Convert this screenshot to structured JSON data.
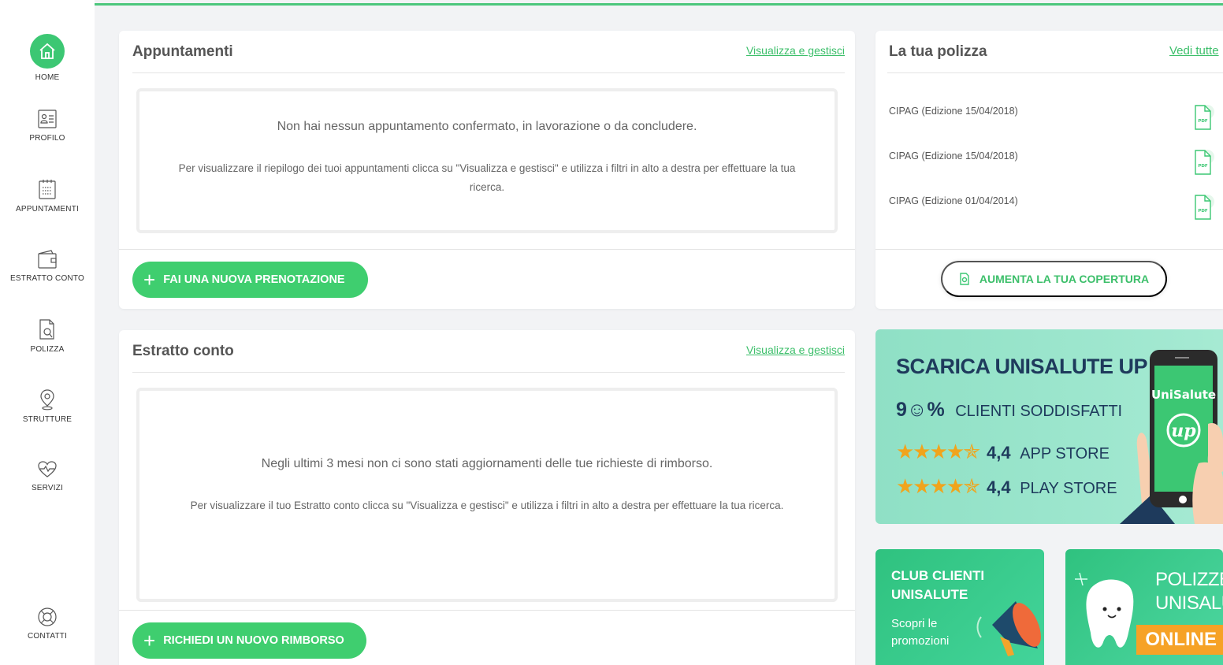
{
  "sidebar": {
    "items": [
      {
        "label": "HOME",
        "icon": "home-icon"
      },
      {
        "label": "PROFILO",
        "icon": "profile-card-icon"
      },
      {
        "label": "APPUNTAMENTI",
        "icon": "calendar-icon"
      },
      {
        "label": "ESTRATTO CONTO",
        "icon": "wallet-icon"
      },
      {
        "label": "POLIZZA",
        "icon": "document-search-icon"
      },
      {
        "label": "STRUTTURE",
        "icon": "location-pin-icon"
      },
      {
        "label": "SERVIZI",
        "icon": "heart-pulse-icon"
      },
      {
        "label": "CONTATTI",
        "icon": "lifebuoy-icon"
      }
    ]
  },
  "appointments": {
    "title": "Appuntamenti",
    "link": "Visualizza e gestisci",
    "empty_main": "Non hai nessun appuntamento confermato, in lavorazione o da concludere.",
    "empty_sub": "Per visualizzare il riepilogo dei tuoi appuntamenti clicca su \"Visualizza e gestisci\" e utilizza i filtri in alto a destra per effettuare la tua ricerca.",
    "button": "FAI UNA NUOVA PRENOTAZIONE"
  },
  "statement": {
    "title": "Estratto conto",
    "link": "Visualizza e gestisci",
    "empty_main": "Negli ultimi 3 mesi non ci sono stati aggiornamenti delle tue richieste di rimborso.",
    "empty_sub": "Per visualizzare il tuo Estratto conto clicca su \"Visualizza e gestisci\" e utilizza i filtri in alto a destra per effettuare la tua ricerca.",
    "button": "RICHIEDI UN NUOVO RIMBORSO"
  },
  "policy": {
    "title": "La tua polizza",
    "link": "Vedi tutte",
    "rows": [
      {
        "name": "CIPAG (Edizione 15/04/2018)",
        "icon": "pdf-icon"
      },
      {
        "name": "CIPAG (Edizione 15/04/2018)",
        "icon": "pdf-icon"
      },
      {
        "name": "CIPAG (Edizione 01/04/2014)",
        "icon": "pdf-icon"
      }
    ],
    "button": "AUMENTA LA TUA COPERTURA",
    "pdf_label": "PDF"
  },
  "banner": {
    "title": "SCARICA UNISALUTE UP",
    "satisfied_num": "9",
    "satisfied_pct": "%",
    "satisfied_text": "CLIENTI SODDISFATTI",
    "rating_app_value": "4,4",
    "rating_app_label": "APP STORE",
    "rating_play_value": "4,4",
    "rating_play_label": "PLAY STORE",
    "phone_brand": "UniSalute",
    "phone_logo": "up"
  },
  "promo_club": {
    "title_line1": "CLUB CLIENTI",
    "title_line2": "UNISALUTE",
    "sub_line1": "Scopri le",
    "sub_line2": "promozioni"
  },
  "promo_online": {
    "line1": "POLIZZE",
    "line2": "UNISALUTE",
    "tag": "ONLINE"
  },
  "colors": {
    "accent": "#3cc773",
    "link": "#3cbf6a",
    "banner_text": "#1e3a5c",
    "stars": "#f0a41c"
  }
}
